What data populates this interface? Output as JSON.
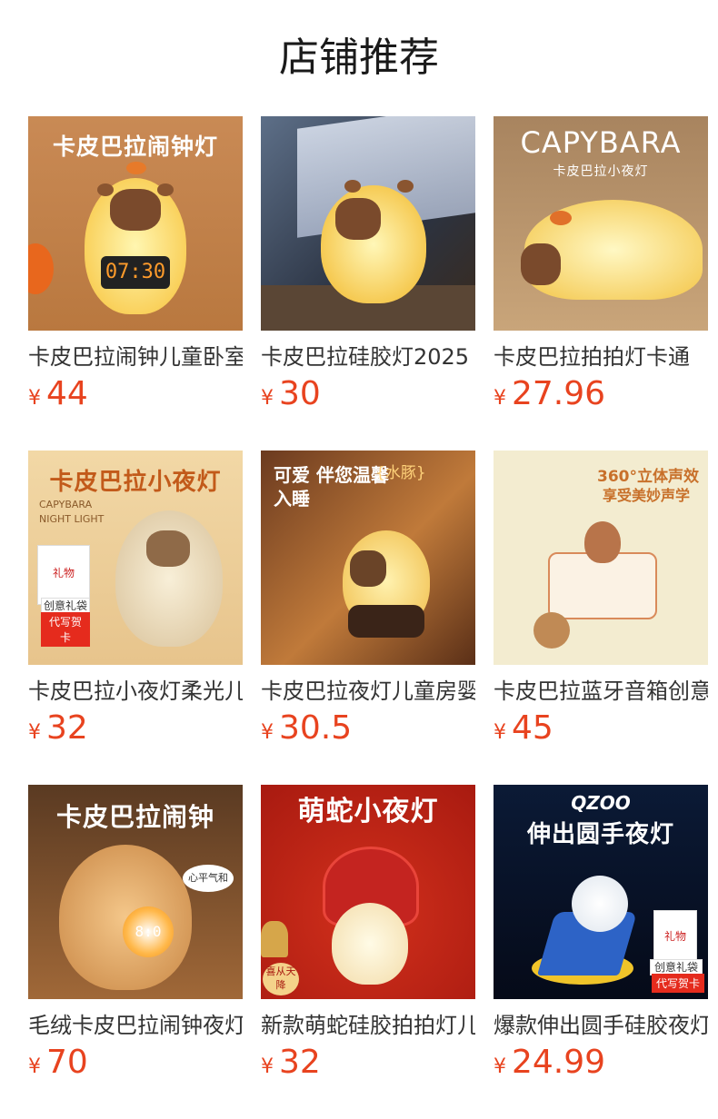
{
  "section_title": "店铺推荐",
  "products": [
    {
      "name": "卡皮巴拉闹钟儿童卧室",
      "currency": "¥",
      "price": "44",
      "image_text": "卡皮巴拉闹钟灯",
      "clock": "07:30"
    },
    {
      "name": "卡皮巴拉硅胶灯2025",
      "currency": "¥",
      "price": "30"
    },
    {
      "name": "卡皮巴拉拍拍灯卡通",
      "currency": "¥",
      "price": "27.96",
      "image_text": "CAPYBARA",
      "image_sub": "卡皮巴拉小夜灯"
    },
    {
      "name": "卡皮巴拉小夜灯柔光儿",
      "currency": "¥",
      "price": "32",
      "image_text": "卡皮巴拉小夜灯",
      "image_sub": "CAPYBARA NIGHT LIGHT",
      "tag1": "创意礼袋",
      "tag2": "代写贺卡"
    },
    {
      "name": "卡皮巴拉夜灯儿童房婴",
      "currency": "¥",
      "price": "30.5",
      "image_text": "可爱 伴您温馨入睡",
      "image_sub": "{水豚}"
    },
    {
      "name": "卡皮巴拉蓝牙音箱创意",
      "currency": "¥",
      "price": "45",
      "image_text": "360°立体声效",
      "image_sub": "享受美妙声学"
    },
    {
      "name": "毛绒卡皮巴拉闹钟夜灯",
      "currency": "¥",
      "price": "70",
      "image_text": "卡皮巴拉闹钟",
      "clock": "8:0",
      "bubble": "心平气和"
    },
    {
      "name": "新款萌蛇硅胶拍拍灯儿",
      "currency": "¥",
      "price": "32",
      "image_text": "萌蛇小夜灯",
      "image_sub": "喜从天降"
    },
    {
      "name": "爆款伸出圆手硅胶夜灯",
      "currency": "¥",
      "price": "24.99",
      "image_text": "伸出圆手夜灯",
      "image_sub": "QZOO",
      "tag1": "创意礼袋",
      "tag2": "代写贺卡"
    }
  ]
}
